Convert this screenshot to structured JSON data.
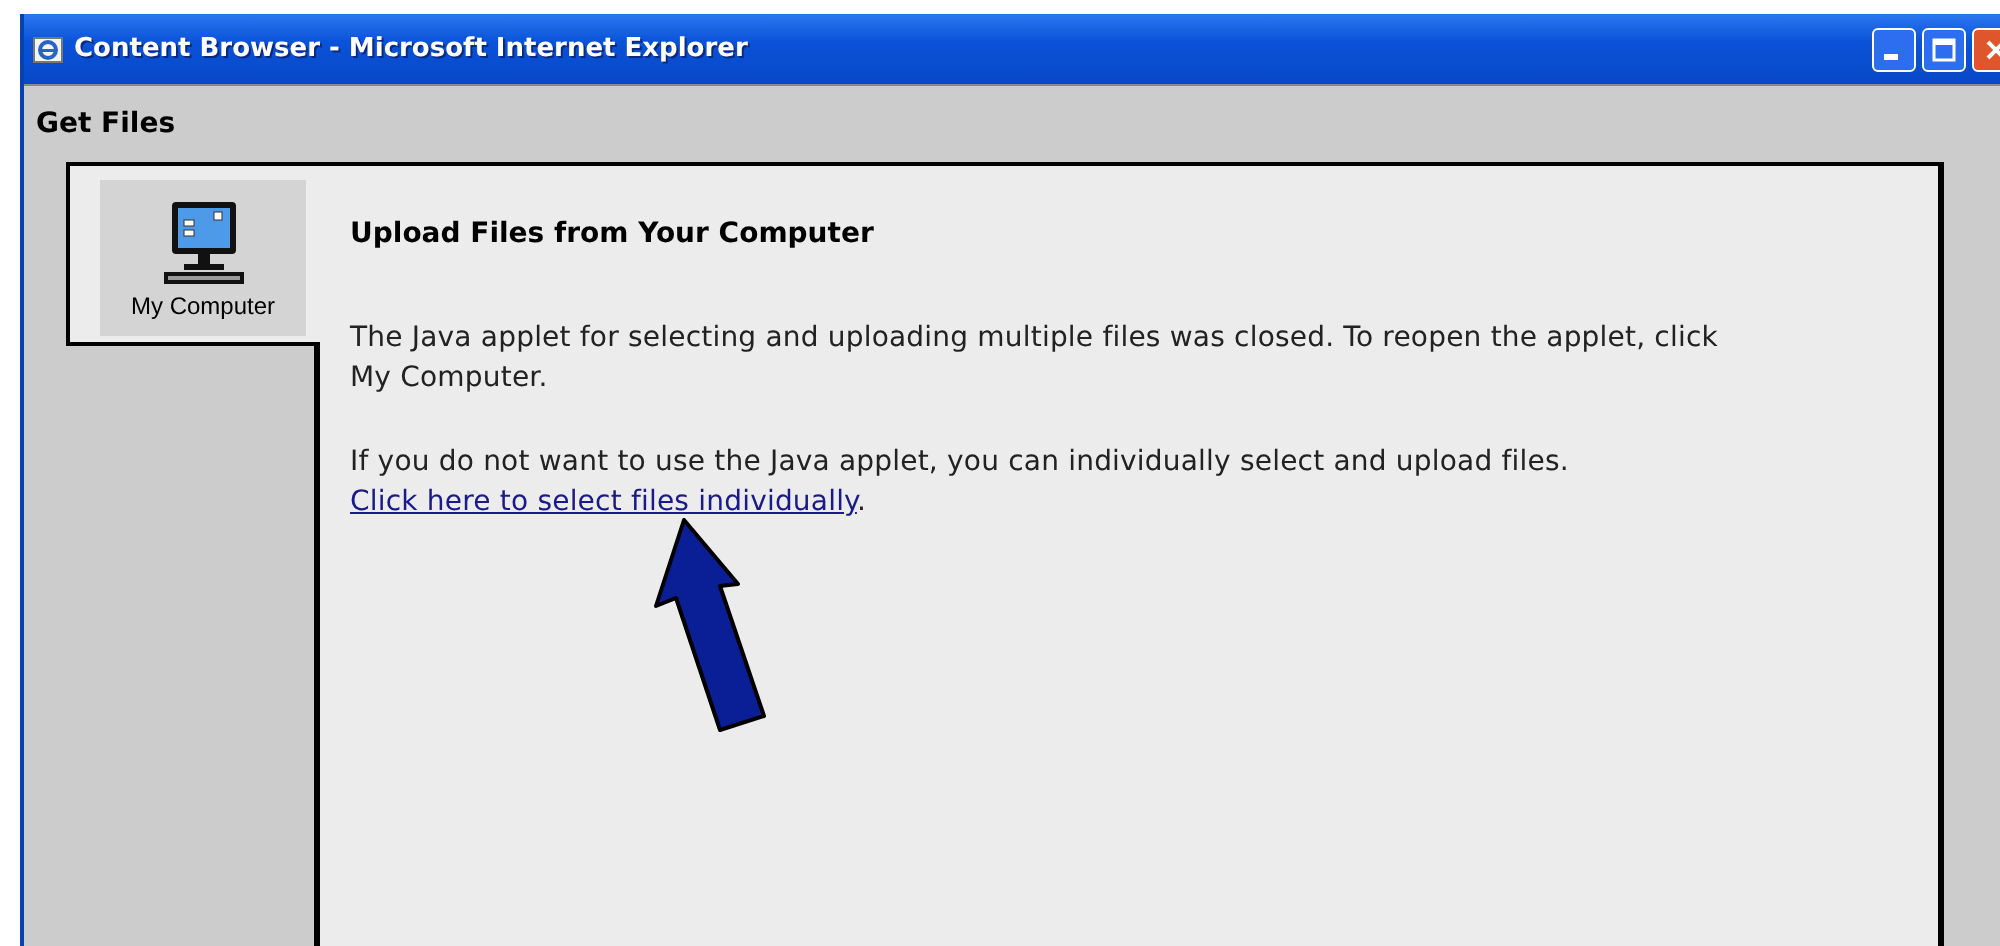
{
  "window": {
    "title": "Content Browser - Microsoft Internet Explorer"
  },
  "page_title": "Get Files",
  "tabs": [
    {
      "label": "My Computer",
      "selected": true
    }
  ],
  "content": {
    "heading": "Upload Files from Your Computer",
    "paragraphs": [
      {
        "text": "The Java applet for selecting and uploading multiple files was closed. To reopen the applet, click My Computer."
      },
      {
        "text": "If you do not want to use the Java applet, you can individually select and upload files.",
        "link": "Click here to select files individually",
        "after_link": "."
      }
    ]
  }
}
